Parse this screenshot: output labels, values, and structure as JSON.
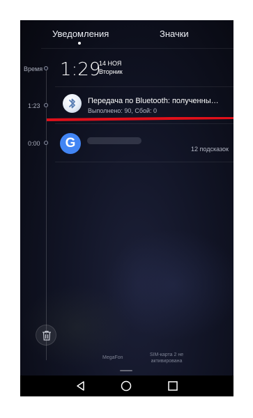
{
  "tabs": {
    "notifications": "Уведомления",
    "badges": "Значки"
  },
  "timeline": {
    "label_time": "Время",
    "label_1": "1:23",
    "label_2": "0:00"
  },
  "clock": {
    "time": "1:29",
    "date_line1": "14 НОЯ",
    "date_line2": "Вторник"
  },
  "notification_bt": {
    "icon": "bluetooth-icon",
    "title": "Передача по Bluetooth: полученны…",
    "subtitle": "Выполнено: 90, Сбой: 0"
  },
  "notification_google": {
    "icon": "google-icon",
    "tips": "12 подсказок"
  },
  "status_bar": {
    "carrier": "MegaFon",
    "sim_status": "SIM-карта 2 не активирована"
  },
  "colors": {
    "annotation": "#e0101a",
    "google_blue": "#4285f4"
  }
}
